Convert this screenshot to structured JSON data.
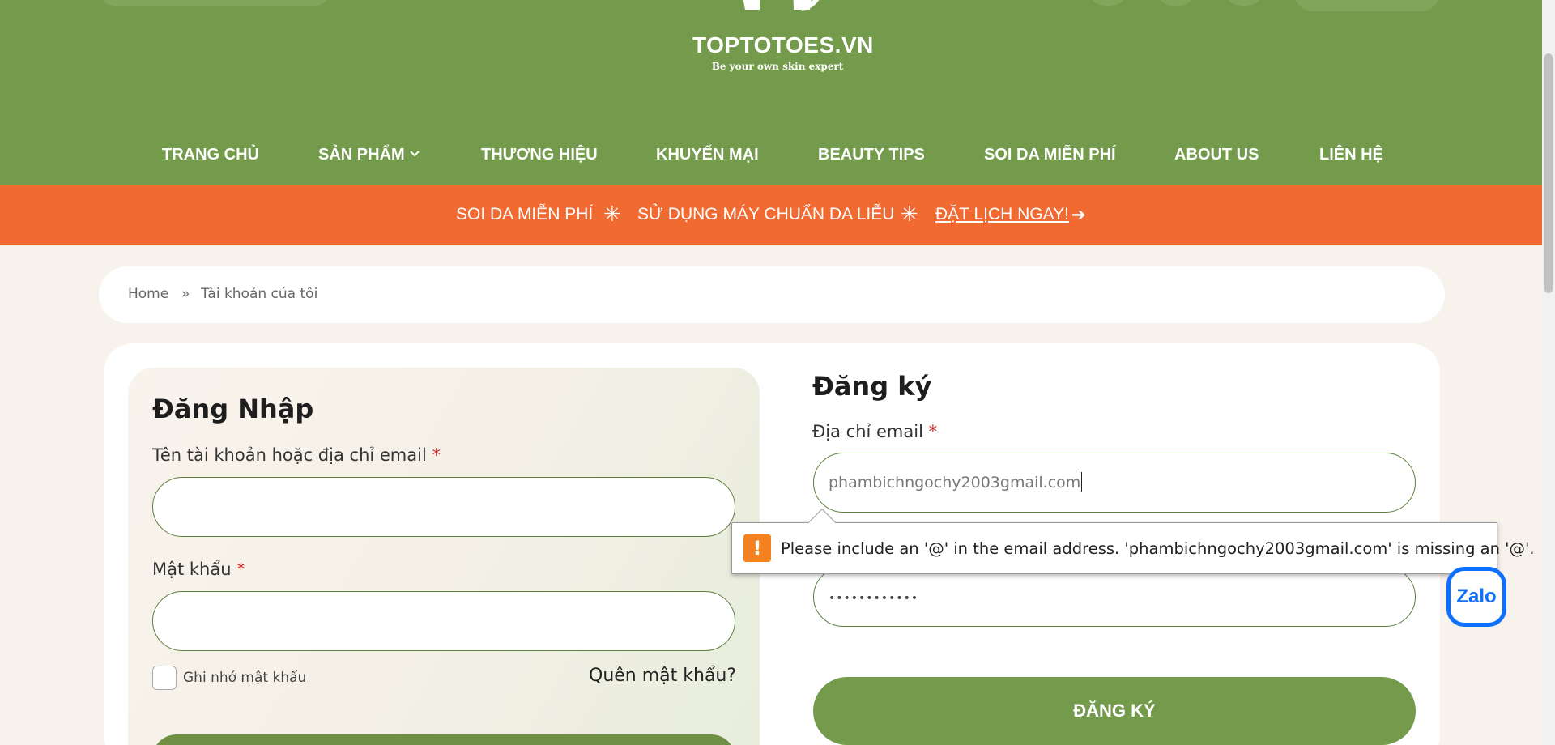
{
  "brand": {
    "logo": "TOPTOTOES.VN",
    "tagline": "Be your own skin expert",
    "accent": "#739b4b",
    "promo_color": "#f06a31"
  },
  "nav": {
    "items": [
      {
        "label": "TRANG CHỦ"
      },
      {
        "label": "SẢN PHẨM",
        "icon": "chevron-down-icon"
      },
      {
        "label": "THƯƠNG HIỆU"
      },
      {
        "label": "KHUYẾN MẠI"
      },
      {
        "label": "BEAUTY TIPS"
      },
      {
        "label": "SOI DA MIỄN PHÍ"
      },
      {
        "label": "ABOUT US"
      },
      {
        "label": "LIÊN HỆ"
      }
    ]
  },
  "promo": {
    "part1": "SOI DA MIỄN PHÍ",
    "star": "✳",
    "part2": "SỬ DỤNG MÁY CHUẨN DA LIỄU",
    "cta": "ĐẶT LỊCH NGAY!",
    "arrow": "➔"
  },
  "breadcrumb": {
    "home": "Home",
    "sep": "»",
    "current": "Tài khoản của tôi"
  },
  "login": {
    "title": "Đăng Nhập",
    "username_label": "Tên tài khoản hoặc địa chỉ email",
    "password_label": "Mật khẩu",
    "required_mark": "*",
    "remember_label": "Ghi nhớ mật khẩu",
    "forgot_label": "Quên mật khẩu?"
  },
  "register": {
    "title": "Đăng ký",
    "email_label": "Địa chỉ email",
    "email_value": "phambichngochy2003gmail.com",
    "password_value": "••••••••••••",
    "button_label": "ĐĂNG KÝ"
  },
  "validation": {
    "icon": "!",
    "message": "Please include an '@' in the email address. 'phambichngochy2003gmail.com' is missing an '@'."
  },
  "zalo": {
    "label": "Zalo"
  }
}
